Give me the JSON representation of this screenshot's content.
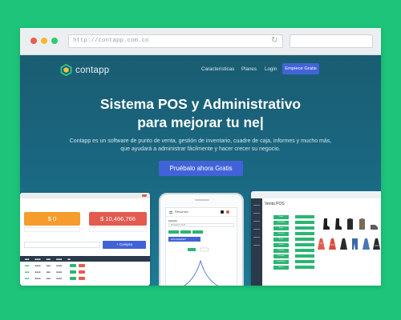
{
  "browser": {
    "url": "http://contapp.com.co",
    "reload_icon": "↻",
    "icons": [
      "close-dot",
      "minimize-dot",
      "maximize-dot",
      "reload-icon"
    ]
  },
  "header": {
    "logo_text": "contapp",
    "nav": [
      "Características",
      "Planes",
      "Login"
    ],
    "cta": "Empiece Gratis"
  },
  "hero": {
    "title_line1": "Sistema POS y Administrativo",
    "title_line2": "para mejorar tu ne|",
    "subtitle": "Contapp es un software de punto de venta, gestión de inventario, cuadre de caja, informes y mucho más, que ayudará a administrar fácilmente y hacer crecer su negocio.",
    "button": "Pruébalo ahora Gratis"
  },
  "dashboard": {
    "card1_value": "$ 0",
    "card2_value": "$ 10,466,766",
    "button": "+ Compra",
    "colors": {
      "orange": "#f59c2c",
      "red": "#e35b4f",
      "blue": "#4263d8",
      "green": "#2bb673"
    }
  },
  "phone": {
    "title": "Resumen",
    "select": "Mostrador CAJA",
    "chart_label": "ETA MARKET"
  },
  "pos": {
    "title": "Venta POS",
    "categories": [
      "Todos",
      "Categoría",
      "Ropa",
      "Camisas",
      "Botas",
      "Jeans",
      "Zapatos",
      "Vestidos",
      "Chaquetas",
      "Bolsos"
    ]
  },
  "colors": {
    "background": "#1ec47a",
    "hero_top": "#1a5d72",
    "hero_bottom": "#1d7a95",
    "accent": "#4263d8"
  }
}
